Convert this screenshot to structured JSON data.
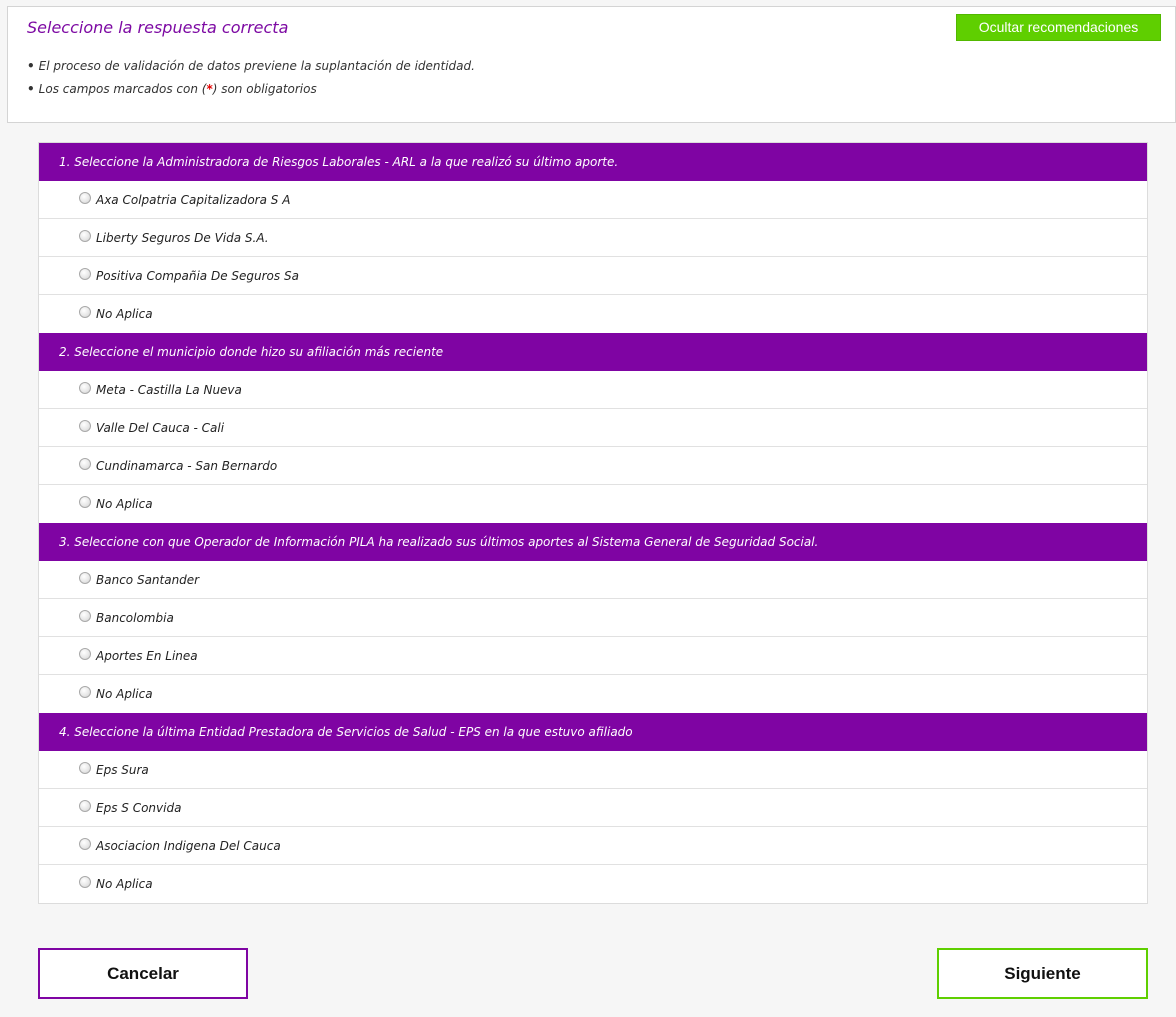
{
  "recommendations": {
    "title": "Seleccione la respuesta correcta",
    "hide_button": "Ocultar recomendaciones",
    "bullet_char": "•",
    "item1": "El proceso de validación de datos previene la suplantación de identidad.",
    "item2_before": "Los campos marcados con (",
    "item2_star": "*",
    "item2_after": ") son obligatorios"
  },
  "questions": [
    {
      "title": "1. Seleccione la Administradora de Riesgos Laborales - ARL a la que realizó su último aporte.",
      "options": [
        "Axa Colpatria Capitalizadora S A",
        "Liberty Seguros De Vida S.A.",
        "Positiva Compañia De Seguros Sa",
        "No Aplica"
      ]
    },
    {
      "title": "2. Seleccione el municipio donde hizo su afiliación más reciente",
      "options": [
        "Meta - Castilla La Nueva",
        "Valle Del Cauca - Cali",
        "Cundinamarca - San Bernardo",
        "No Aplica"
      ]
    },
    {
      "title": "3. Seleccione con que Operador de Información PILA ha realizado sus últimos aportes al Sistema General de Seguridad Social.",
      "options": [
        "Banco Santander",
        "Bancolombia",
        "Aportes En Linea",
        "No Aplica"
      ]
    },
    {
      "title": "4. Seleccione la última Entidad Prestadora de Servicios de Salud - EPS en la que estuvo afiliado",
      "options": [
        "Eps Sura",
        "Eps S Convida",
        "Asociacion Indigena Del Cauca",
        "No Aplica"
      ]
    }
  ],
  "buttons": {
    "cancel": "Cancelar",
    "next": "Siguiente"
  },
  "colors": {
    "accent_purple": "#7f04a3",
    "accent_green": "#5fcf00",
    "required_red": "#e30000"
  }
}
